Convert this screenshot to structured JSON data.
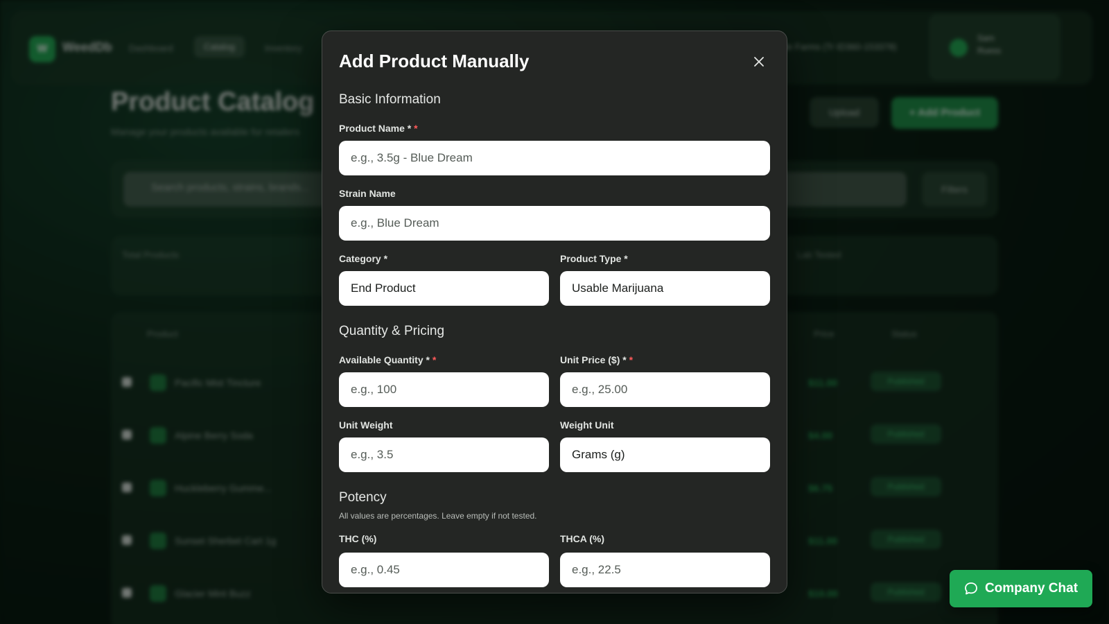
{
  "background": {
    "brand": "WeedDb",
    "nav": [
      "Dashboard",
      "Catalog",
      "Inventory"
    ],
    "active_nav": "Catalog",
    "location": "Cascade Farms (Tr ID360-153378)",
    "user": "Sam Ruess",
    "page_title": "Product Catalog",
    "page_subtitle": "Manage your products available for retailers",
    "upload_label": "Upload",
    "add_product_label": "+ Add Product",
    "search_placeholder": "Search products, strains, brands...",
    "filters_label": "Filters",
    "stats": [
      "Total Products",
      "Lab Tested"
    ],
    "table_headers": [
      "Product",
      "Price",
      "Status"
    ],
    "rows": [
      {
        "name": "Pacific Mist Tincture",
        "price": "$11.00",
        "status": "Published"
      },
      {
        "name": "Alpine Berry Soda",
        "price": "$4.00",
        "status": "Published"
      },
      {
        "name": "Huckleberry Gumme...",
        "price": "$6.75",
        "status": "Published"
      },
      {
        "name": "Sunset Sherbet Cart 1g",
        "price": "$11.00",
        "status": "Published"
      },
      {
        "name": "Glacier Mint Buzz",
        "price": "$10.00",
        "status": "Published"
      }
    ]
  },
  "modal": {
    "title": "Add Product Manually",
    "sections": {
      "basic": "Basic Information",
      "quantity": "Quantity & Pricing",
      "potency": "Potency"
    },
    "potency_hint": "All values are percentages. Leave empty if not tested.",
    "fields": {
      "product_name": {
        "label": "Product Name *",
        "placeholder": "e.g., 3.5g - Blue Dream"
      },
      "strain_name": {
        "label": "Strain Name",
        "placeholder": "e.g., Blue Dream"
      },
      "category": {
        "label": "Category *",
        "value": "End Product"
      },
      "product_type": {
        "label": "Product Type *",
        "value": "Usable Marijuana"
      },
      "available_quantity": {
        "label": "Available Quantity *",
        "placeholder": "e.g., 100"
      },
      "unit_price": {
        "label": "Unit Price ($) *",
        "placeholder": "e.g., 25.00"
      },
      "unit_weight": {
        "label": "Unit Weight",
        "placeholder": "e.g., 3.5"
      },
      "weight_unit": {
        "label": "Weight Unit",
        "value": "Grams (g)"
      },
      "thc": {
        "label": "THC (%)",
        "placeholder": "e.g., 0.45"
      },
      "thca": {
        "label": "THCA (%)",
        "placeholder": "e.g., 22.5"
      }
    },
    "required_marker": "*"
  },
  "chat_button": {
    "label": "Company Chat"
  },
  "colors": {
    "accent": "#1fa955",
    "required": "#ff5a5a",
    "modal_bg": "#242624"
  }
}
